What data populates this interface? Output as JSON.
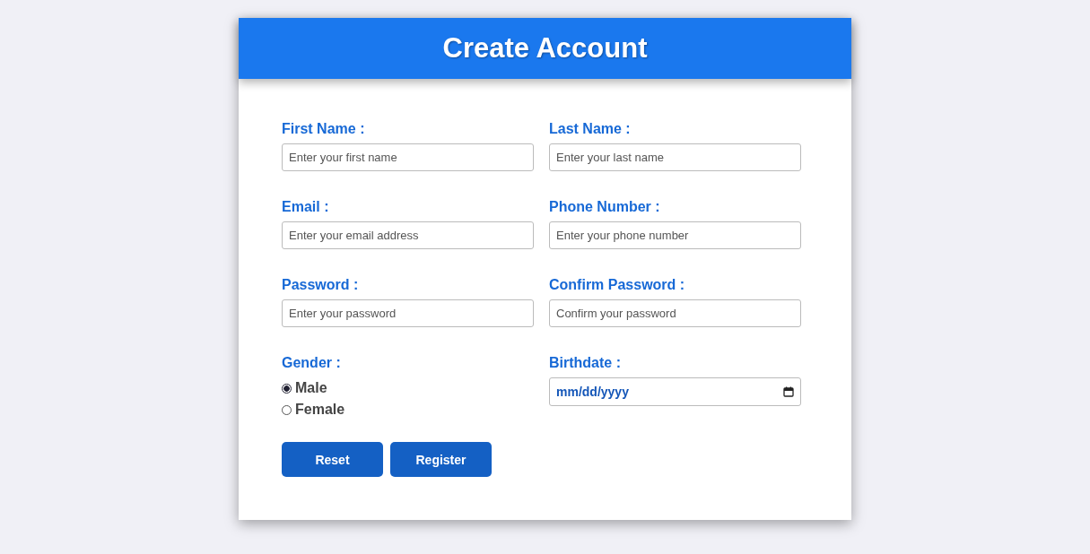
{
  "header": {
    "title": "Create Account"
  },
  "fields": [
    {
      "kind": "text",
      "label": "First Name :",
      "placeholder": "Enter your first name"
    },
    {
      "kind": "text",
      "label": "Last Name :",
      "placeholder": "Enter your last name"
    },
    {
      "kind": "text",
      "label": "Email :",
      "placeholder": "Enter your email address"
    },
    {
      "kind": "text",
      "label": "Phone Number :",
      "placeholder": "Enter your phone number"
    },
    {
      "kind": "text",
      "label": "Password :",
      "placeholder": "Enter your password"
    },
    {
      "kind": "text",
      "label": "Confirm Password :",
      "placeholder": "Confirm your password"
    },
    {
      "kind": "radio",
      "label": "Gender :",
      "options": [
        {
          "label": "Male",
          "selected": true
        },
        {
          "label": "Female",
          "selected": false
        }
      ]
    },
    {
      "kind": "date",
      "label": "Birthdate :",
      "value": "mm/dd/yyyy"
    }
  ],
  "buttons": [
    "Reset",
    "Register"
  ]
}
